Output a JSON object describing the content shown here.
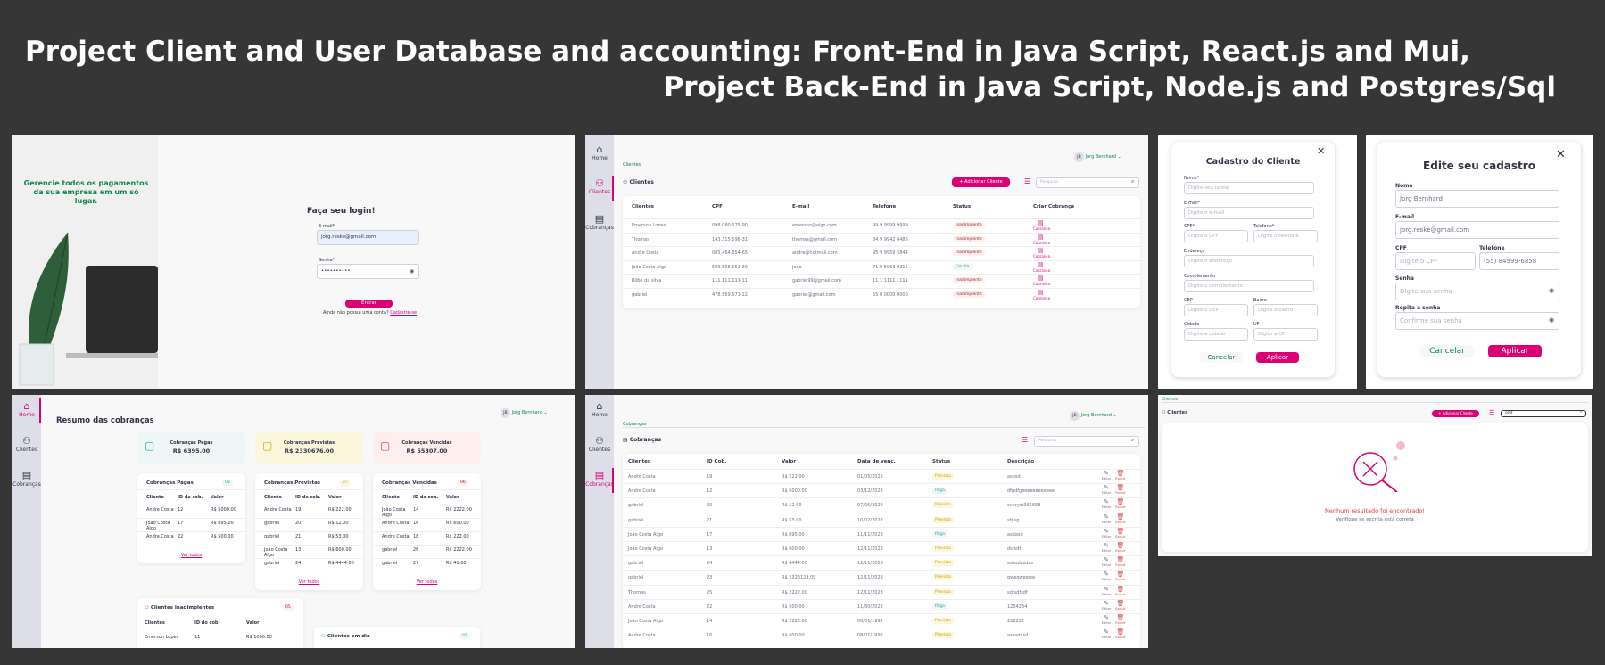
{
  "title_line1_bold": "Project Client and User Database and accounting",
  "title_line1_rest": ": Front-End in Java Script, React.js and Mui,",
  "title_line2": "Project Back-End in Java Script, Node.js and Postgres/Sql",
  "colors": {
    "accent": "#da0175",
    "green": "#0e8750",
    "sidebar": "#dedee9",
    "bg": "#363636"
  },
  "login": {
    "tagline": "Gerencie todos os pagamentos da sua empresa em um só lugar.",
    "heading": "Faça seu login!",
    "email_label": "E-mail*",
    "email_value": "jorg.reske@gmail.com",
    "password_label": "Senha*",
    "password_value": "••••••••••",
    "submit": "Entrar",
    "signup_text": "Ainda não possui uma conta?",
    "signup_link": "Cadastre-se"
  },
  "nav": {
    "home": "Home",
    "clients": "Clientes",
    "charges": "Cobranças"
  },
  "user": {
    "initials": "JB",
    "name": "Jorg Bernhard"
  },
  "clients": {
    "breadcrumb": "Clientes",
    "heading": "Clientes",
    "add_button": "+ Adicionar Cliente",
    "search_placeholder": "Pesquisa",
    "columns": [
      "Clientes",
      "CPF",
      "E-mail",
      "Telefone",
      "Status",
      "Criar Cobrança"
    ],
    "rows": [
      {
        "name": "Emerson Lopes",
        "cpf": "098.080.575-90",
        "email": "emerson@algo.com",
        "phone": "99 9 9999 9999",
        "status": "Inadimplente",
        "st": "red"
      },
      {
        "name": "Thomas",
        "cpf": "143.315.598-31",
        "email": "thomas@gmail.com",
        "phone": "84 9 9942 0486",
        "status": "Inadimplente",
        "st": "red"
      },
      {
        "name": "Andre Costa",
        "cpf": "085.464.654-65",
        "email": "andre@hotmail.com",
        "phone": "95 9 9959 5844",
        "status": "Inadimplente",
        "st": "red"
      },
      {
        "name": "João Costa Algo",
        "cpf": "509.508.652-30",
        "email": "joao",
        "phone": "71 9 5963 9215",
        "status": "Em dia",
        "st": "blue"
      },
      {
        "name": "Bilbo da silva",
        "cpf": "111.111.111-11",
        "email": "gabriel99@gmail.com",
        "phone": "11 1 1111 1111",
        "status": "Inadimplente",
        "st": "red"
      },
      {
        "name": "gabriel",
        "cpf": "478.569.671-22",
        "email": "gabriel@gmail.com",
        "phone": "55 0 0000 0000",
        "status": "Inadimplente",
        "st": "red"
      }
    ],
    "create_charge": "Cobrança"
  },
  "modal_client": {
    "title": "Cadastro do Cliente",
    "name_label": "Nome*",
    "name_ph": "Digite seu nome",
    "email_label": "E-mail*",
    "email_ph": "Digite o e-mail",
    "cpf_label": "CPF*",
    "cpf_ph": "Digite o CPF",
    "phone_label": "Telefone*",
    "phone_ph": "Digite o telefone",
    "address_label": "Endereço",
    "address_ph": "Digite o endereço",
    "complement_label": "Complemento",
    "complement_ph": "Digite o complemento",
    "cep_label": "CEP",
    "cep_ph": "Digite o CEP",
    "district_label": "Bairro",
    "district_ph": "Digite o bairro",
    "city_label": "Cidade",
    "city_ph": "Digite a cidade",
    "uf_label": "UF",
    "uf_ph": "Digite a UF",
    "cancel": "Cancelar",
    "apply": "Aplicar"
  },
  "modal_edit": {
    "title": "Edite seu cadastro",
    "name_label": "Nome",
    "name_value": "Jorg Bernhard",
    "email_label": "E-mail",
    "email_value": "jorg.reske@gmail.com",
    "cpf_label": "CPF",
    "cpf_ph": "Digite o CPF",
    "phone_label": "Telefone",
    "phone_value": "(55) 84999-6858",
    "pass_label": "Senha",
    "pass_ph": "Digite sua senha",
    "repeat_label": "Repita a senha",
    "repeat_ph": "Confirme sua senha",
    "cancel": "Cancelar",
    "apply": "Aplicar"
  },
  "dashboard": {
    "heading": "Resumo das cobranças",
    "summary": [
      {
        "label": "Cobranças Pagas",
        "value": "R$ 6395.00"
      },
      {
        "label": "Cobranças Previstas",
        "value": "R$ 2330676.00"
      },
      {
        "label": "Cobranças Vencidas",
        "value": "R$ 55307.00"
      }
    ],
    "cols": [
      "Cliente",
      "ID da cob.",
      "Valor"
    ],
    "paid": {
      "title": "Cobranças Pagas",
      "count": "03",
      "rows": [
        [
          "Andre Costa",
          "12",
          "R$ 5000.00"
        ],
        [
          "João Costa Algo",
          "17",
          "R$ 895.00"
        ],
        [
          "Andre Costa",
          "22",
          "R$ 500.00"
        ]
      ]
    },
    "expected": {
      "title": "Cobranças Previstas",
      "count": "37",
      "rows": [
        [
          "Andre Costa",
          "19",
          "R$ 222.00"
        ],
        [
          "gabriel",
          "20",
          "R$ 12.00"
        ],
        [
          "gabriel",
          "21",
          "R$ 53.00"
        ],
        [
          "João Costa Algo",
          "13",
          "R$ 600.00"
        ],
        [
          "gabriel",
          "24",
          "R$ 4444.00"
        ]
      ]
    },
    "overdue": {
      "title": "Cobranças Vencidas",
      "count": "06",
      "rows": [
        [
          "João Costa Algo",
          "14",
          "R$ 2222.00"
        ],
        [
          "Andre Costa",
          "16",
          "R$ 600.00"
        ],
        [
          "Andre Costa",
          "18",
          "R$ 222.00"
        ],
        [
          "gabriel",
          "26",
          "R$ 2222.00"
        ],
        [
          "gabriel",
          "27",
          "R$ 41.00"
        ]
      ]
    },
    "see_all": "Ver todos",
    "defaulters": {
      "title": "Clientes Inadimplentes",
      "count": "05",
      "cols": [
        "Clientes",
        "ID do cob.",
        "Valor"
      ],
      "row": [
        "Emerson Lopes",
        "11",
        "R$ 1000.00"
      ]
    },
    "ontime": {
      "title": "Clientes em dia",
      "count": "01"
    }
  },
  "charges": {
    "breadcrumb": "Cobranças",
    "heading": "Cobranças",
    "search_placeholder": "Pesquisa",
    "columns": [
      "Clientes",
      "ID Cob.",
      "Valor",
      "Data de venc.",
      "Status",
      "Descrição"
    ],
    "rows": [
      [
        "Andre Costa",
        "19",
        "R$ 222.00",
        "01/05/2025",
        "Prevista",
        "asbsd",
        "yel"
      ],
      [
        "Andre Costa",
        "12",
        "R$ 5000.00",
        "03/12/2023",
        "Paga",
        "dfgdfgeeeeeeeeeeee",
        "blue"
      ],
      [
        "gabriel",
        "20",
        "R$ 12.00",
        "07/05/2022",
        "Prevista",
        "cvxryct365658",
        "yel"
      ],
      [
        "gabriel",
        "21",
        "R$ 53.00",
        "10/02/2022",
        "Prevista",
        "sfgsg",
        "yel"
      ],
      [
        "João Costa Algo",
        "17",
        "R$ 895.00",
        "11/11/2023",
        "Paga",
        "asdasd",
        "blue"
      ],
      [
        "João Costa Algo",
        "13",
        "R$ 600.00",
        "12/11/2023",
        "Prevista",
        "dsfsdf",
        "yel"
      ],
      [
        "gabriel",
        "24",
        "R$ 4444.00",
        "12/11/2023",
        "Prevista",
        "sdasdasdas",
        "yel"
      ],
      [
        "gabriel",
        "23",
        "R$ 2323123.00",
        "12/11/2023",
        "Prevista",
        "qweqweqwe",
        "yel"
      ],
      [
        "Thomas",
        "25",
        "R$ 2222.00",
        "12/11/2023",
        "Prevista",
        "sdfsdfsdf",
        "yel"
      ],
      [
        "Andre Costa",
        "22",
        "R$ 500.00",
        "11/30/2022",
        "Paga",
        "1234234",
        "blue"
      ],
      [
        "João Costa Algo",
        "14",
        "R$ 2222.00",
        "08/01/1992",
        "Prevista",
        "222222",
        "yel"
      ],
      [
        "Andre Costa",
        "16",
        "R$ 600.00",
        "08/01/1992",
        "Prevista",
        "asasdasd",
        "yel"
      ]
    ],
    "edit": "Editar",
    "delete": "Excluir"
  },
  "empty": {
    "breadcrumb": "Clientes",
    "heading": "Clientes",
    "add_button": "+ Adicionar Cliente",
    "search_value": "ond",
    "message": "Nenhum resultado foi encontrado!",
    "hint": "Verifique se escrita está correta"
  }
}
